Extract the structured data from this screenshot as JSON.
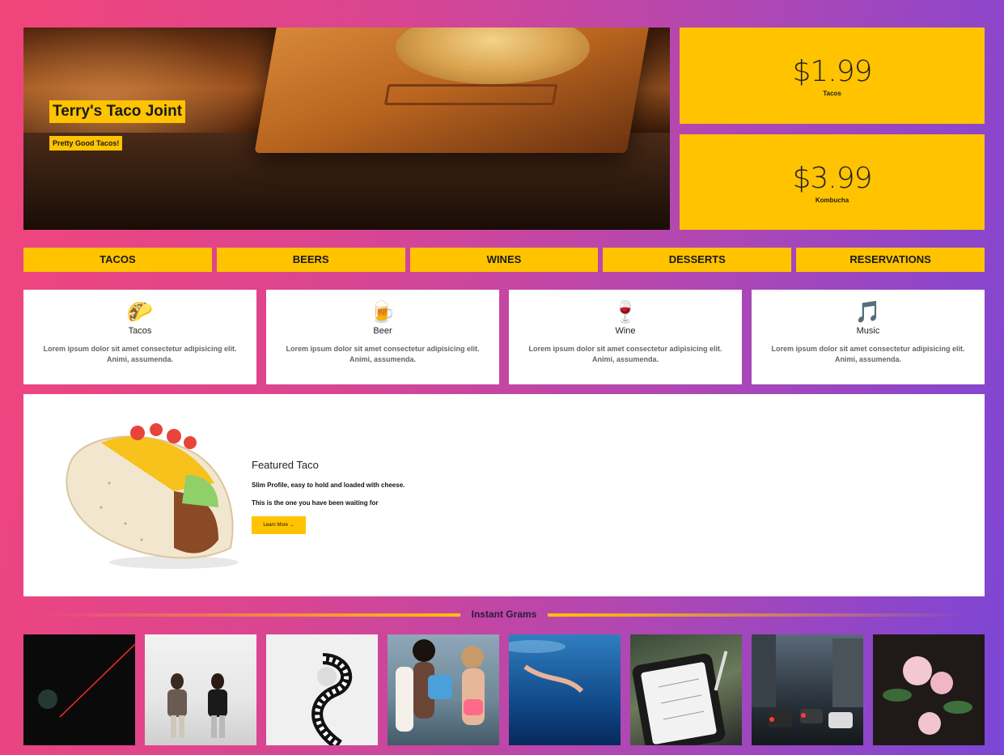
{
  "hero": {
    "title": "Terry's Taco Joint",
    "subtitle": "Pretty Good Tacos!"
  },
  "prices": [
    {
      "amount": "$1.99",
      "label": "Tacos"
    },
    {
      "amount": "$3.99",
      "label": "Kombucha"
    }
  ],
  "nav": [
    "TACOS",
    "BEERS",
    "WINES",
    "DESSERTS",
    "RESERVATIONS"
  ],
  "cards": [
    {
      "icon": "taco-icon",
      "glyph": "🌮",
      "title": "Tacos",
      "text": "Lorem ipsum dolor sit amet consectetur adipisicing elit. Animi, assumenda."
    },
    {
      "icon": "beer-icon",
      "glyph": "🍺",
      "title": "Beer",
      "text": "Lorem ipsum dolor sit amet consectetur adipisicing elit. Animi, assumenda."
    },
    {
      "icon": "wine-icon",
      "glyph": "🍷",
      "title": "Wine",
      "text": "Lorem ipsum dolor sit amet consectetur adipisicing elit. Animi, assumenda."
    },
    {
      "icon": "music-icon",
      "glyph": "🎵",
      "title": "Music",
      "text": "Lorem ipsum dolor sit amet consectetur adipisicing elit. Animi, assumenda."
    }
  ],
  "featured": {
    "title": "Featured Taco",
    "line1": "Slim Profile, easy to hold and loaded with cheese.",
    "line2": "This is the one you have been waiting for",
    "button": "Learn More →"
  },
  "insta": {
    "heading": "Instant Grams"
  },
  "colors": {
    "accent": "#ffc300",
    "bg_start": "#f2457a",
    "bg_end": "#7b46d6"
  }
}
